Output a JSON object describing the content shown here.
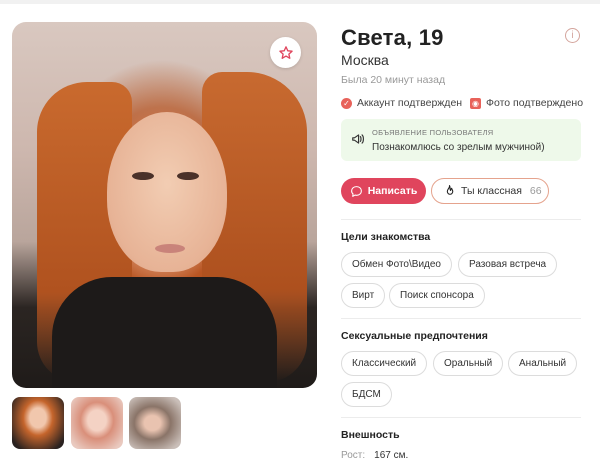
{
  "profile": {
    "name_age": "Света, 19",
    "city": "Москва",
    "last_seen": "Была 20 минут назад",
    "verified_account": "Аккаунт подтвержден",
    "verified_photo": "Фото подтверждено",
    "ad": {
      "title": "объявление пользователя",
      "text": "Познакомлюсь со зрелым мужчиной)"
    }
  },
  "actions": {
    "write_label": "Написать",
    "like_label": "Ты классная",
    "like_count": "66"
  },
  "goals": {
    "title": "Цели знакомства",
    "items": [
      "Обмен Фото\\Видео",
      "Разовая встреча",
      "Вирт",
      "Поиск спонсора"
    ]
  },
  "preferences": {
    "title": "Сексуальные предпочтения",
    "items": [
      "Классический",
      "Оральный",
      "Анальный",
      "БДСМ"
    ]
  },
  "appearance": {
    "title": "Внешность",
    "height_label": "Рост:",
    "height_value": "167 см."
  },
  "icons": {
    "favorite": "star-icon",
    "info": "info-icon",
    "verified": "check-circle-icon",
    "photo": "camera-icon",
    "ad": "megaphone-icon",
    "message": "chat-bubble-icon",
    "like": "flame-icon"
  },
  "colors": {
    "accent": "#e0455d",
    "ad_background": "#eef9ea",
    "like_border": "#e5a38d"
  }
}
